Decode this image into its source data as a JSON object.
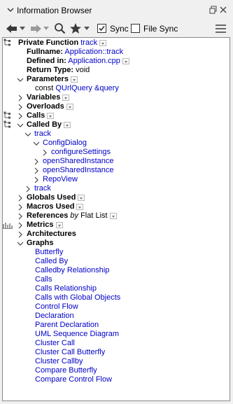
{
  "window": {
    "title": "Information Browser"
  },
  "toolbar": {
    "sync_label": "Sync",
    "sync_checked": true,
    "filesync_label": "File Sync",
    "filesync_checked": false
  },
  "tree": {
    "private_function": {
      "key": "Private Function",
      "value": "track"
    },
    "fullname": {
      "key": "Fullname:",
      "value": "Application::track"
    },
    "defined_in": {
      "key": "Defined in:",
      "value": "Application.cpp"
    },
    "return_type": {
      "key": "Return Type:",
      "value": "void"
    },
    "parameters": {
      "label": "Parameters",
      "param_prefix": "const",
      "param_type": "QUrlQuery",
      "param_name": "&query"
    },
    "variables": "Variables",
    "overloads": "Overloads",
    "calls": "Calls",
    "called_by": {
      "label": "Called By",
      "track1": "track",
      "configdialog": "ConfigDialog",
      "configure_settings": "configureSettings",
      "open_shared_instance_1": "openSharedInstance",
      "open_shared_instance_2": "openSharedInstance",
      "repoview": "RepoView",
      "track2": "track"
    },
    "globals_used": "Globals Used",
    "macros_used": "Macros Used",
    "references": {
      "label": "References",
      "by": "by",
      "mode": "Flat List"
    },
    "metrics": "Metrics",
    "architectures": "Architectures",
    "graphs": {
      "label": "Graphs",
      "items": [
        "Butterfly",
        "Called By",
        "Calledby Relationship",
        "Calls",
        "Calls Relationship",
        "Calls with Global Objects",
        "Control Flow",
        "Declaration",
        "Parent Declaration",
        "UML Sequence Diagram",
        "Cluster Call",
        "Cluster Call Butterfly",
        "Cluster Callby",
        "Compare Butterfly",
        "Compare Control Flow"
      ]
    }
  }
}
